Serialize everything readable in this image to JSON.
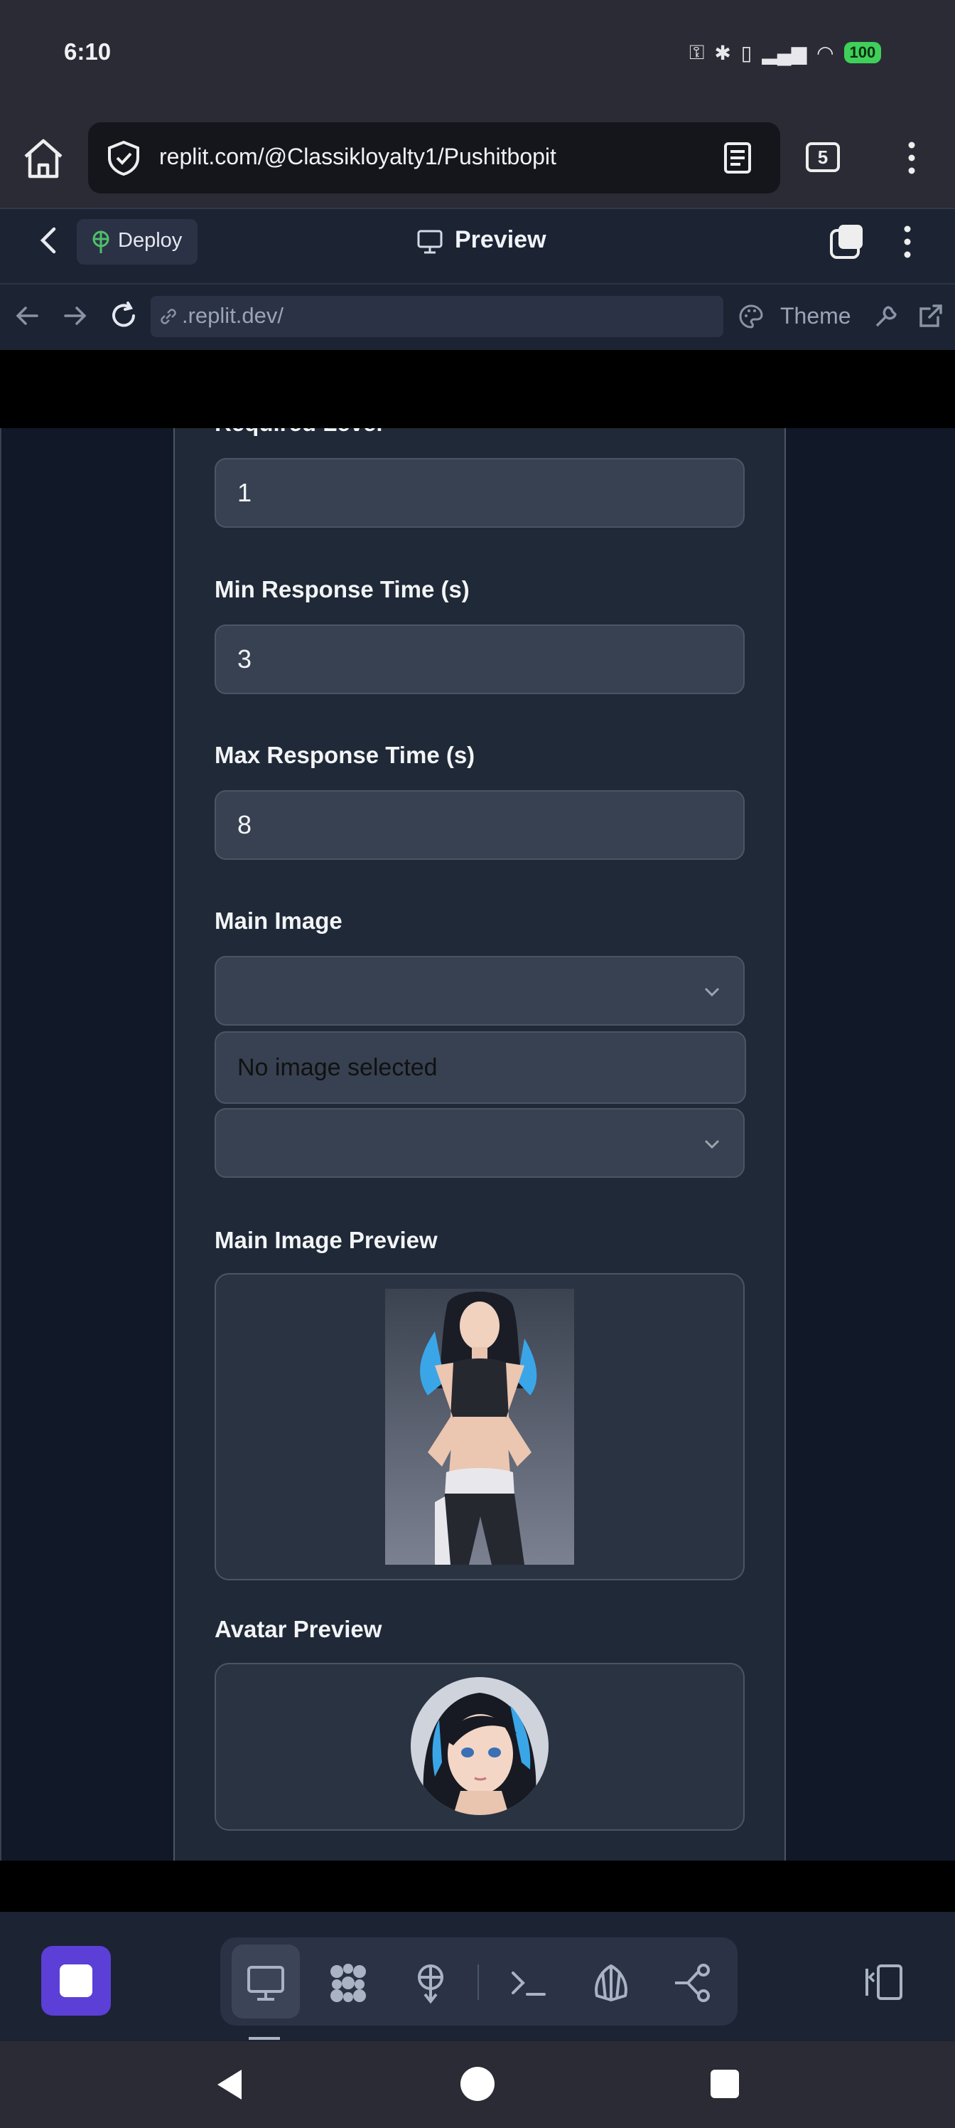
{
  "status_bar": {
    "time": "6:10",
    "battery": "100"
  },
  "browser": {
    "url": "replit.com/@Classikloyalty1/Pushitbopit",
    "tab_count": "5"
  },
  "replit_header": {
    "deploy_label": "Deploy",
    "preview_label": "Preview"
  },
  "preview_nav": {
    "address": ".replit.dev/",
    "theme_label": "Theme"
  },
  "form": {
    "required_level_label": "Required Level",
    "required_level_value": "1",
    "min_response_label": "Min Response Time (s)",
    "min_response_value": "3",
    "max_response_label": "Max Response Time (s)",
    "max_response_value": "8",
    "main_image_label": "Main Image",
    "no_image_text": "No image selected",
    "main_image_preview_label": "Main Image Preview",
    "avatar_preview_label": "Avatar Preview"
  },
  "colors": {
    "accent": "#5b3fd6",
    "page_bg": "#111827",
    "card_bg": "#1f2937",
    "input_bg": "#374151"
  }
}
